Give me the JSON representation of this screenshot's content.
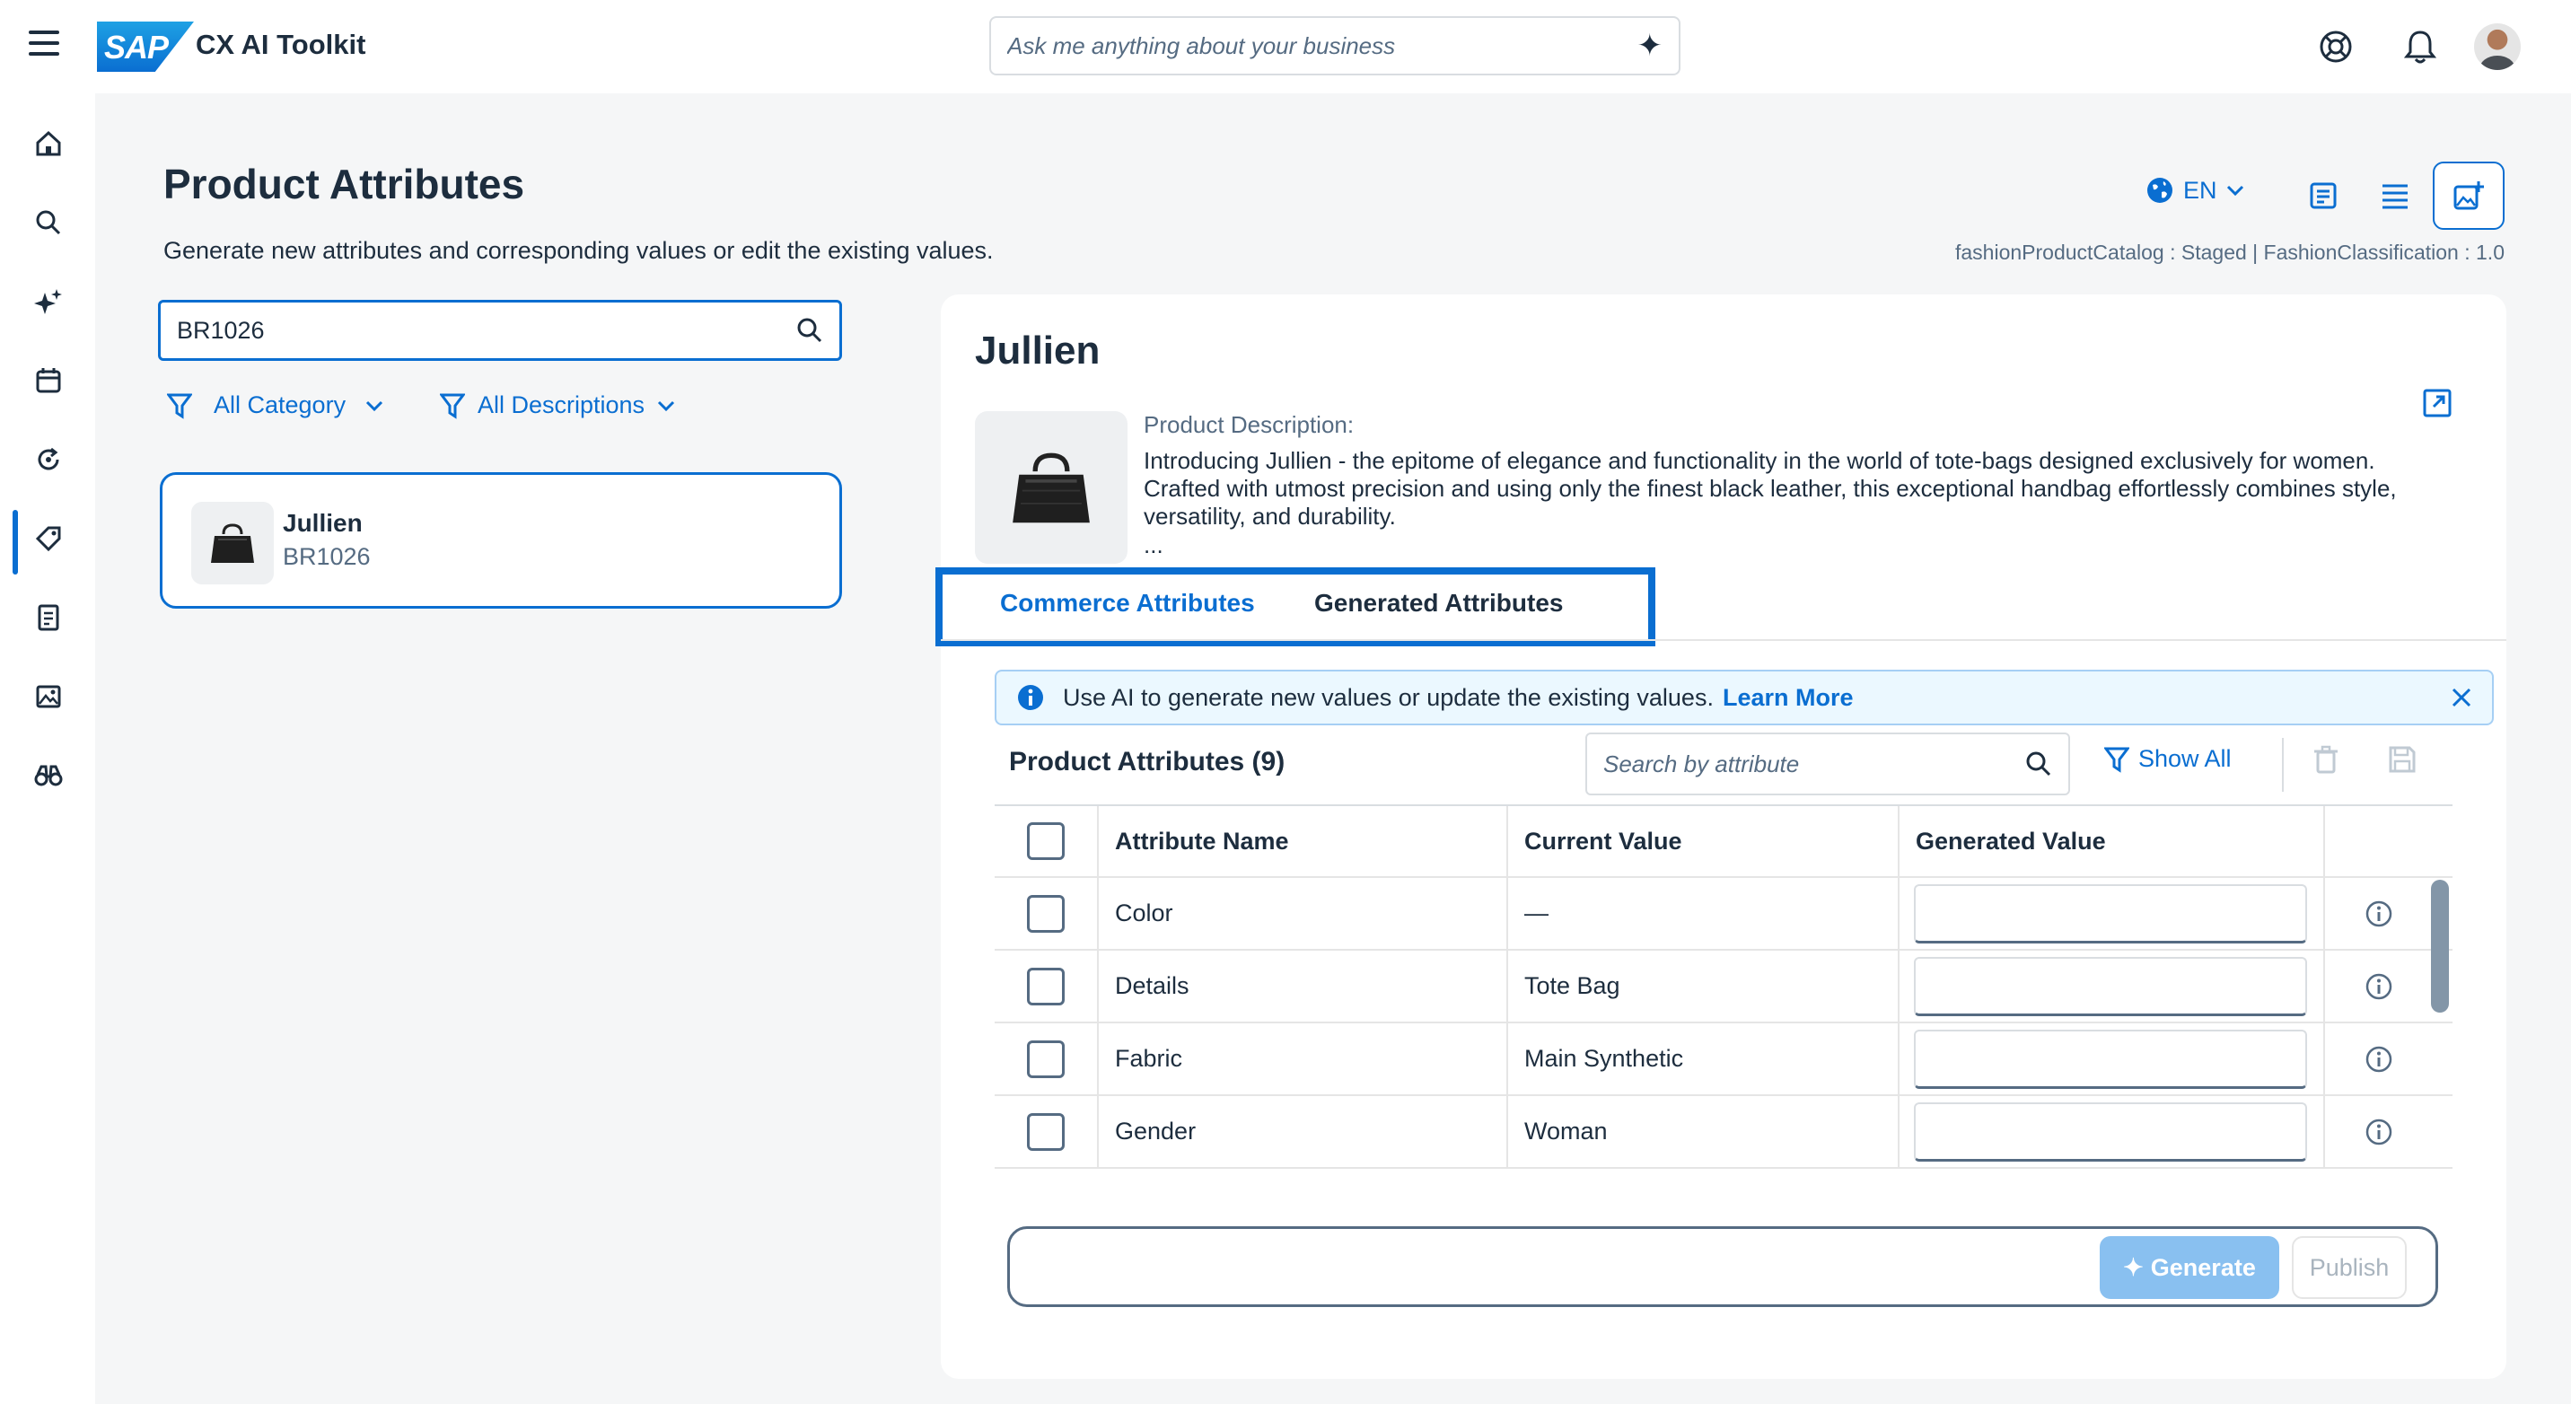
{
  "shell": {
    "brand": "SAP",
    "app_title": "CX AI Toolkit",
    "ask_placeholder": "Ask me anything about your business"
  },
  "page": {
    "title": "Product Attributes",
    "subtitle": "Generate new attributes and corresponding values or edit the existing values.",
    "language": "EN",
    "catalog_info": "fashionProductCatalog : Staged | FashionClassification : 1.0"
  },
  "search": {
    "value": "BR1026"
  },
  "filters": {
    "category": "All Category",
    "descriptions": "All Descriptions"
  },
  "product_list": [
    {
      "name": "Jullien",
      "code": "BR1026"
    }
  ],
  "detail": {
    "title": "Jullien",
    "description_label": "Product Description:",
    "description": "Introducing Jullien - the epitome of elegance and functionality in the world of tote-bags designed exclusively for women. Crafted with utmost precision and using only the finest black leather, this exceptional handbag effortlessly combines style, versatility, and durability.",
    "description_more": "...",
    "tabs": [
      "Commerce Attributes",
      "Generated Attributes"
    ],
    "info_text": "Use AI to generate new values or update the existing values.",
    "info_link": "Learn More",
    "table_title": "Product Attributes (9)",
    "attr_search_placeholder": "Search by attribute",
    "show_all": "Show All",
    "columns": [
      "Attribute Name",
      "Current Value",
      "Generated Value"
    ],
    "rows": [
      {
        "name": "Color",
        "current": "—"
      },
      {
        "name": "Details",
        "current": "Tote Bag"
      },
      {
        "name": "Fabric",
        "current": "Main Synthetic"
      },
      {
        "name": "Gender",
        "current": "Woman"
      }
    ],
    "generate_label": "Generate",
    "publish_label": "Publish"
  },
  "colors": {
    "accent": "#0a6ed1",
    "text": "#1d2d3e",
    "muted": "#556b82",
    "info_bg": "#ebf8ff"
  },
  "icons": {
    "nav": [
      "home-icon",
      "search-icon",
      "sparkle-icon",
      "calendar-icon",
      "refresh-icon",
      "tag-icon",
      "document-icon",
      "image-icon",
      "binoculars-icon"
    ]
  }
}
